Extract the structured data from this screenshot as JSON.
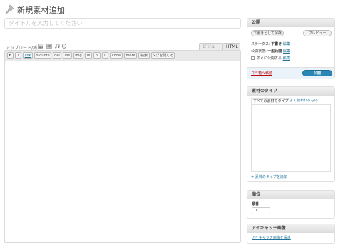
{
  "header": {
    "title": "新規素材追加",
    "icon": "pin-icon"
  },
  "title_field": {
    "placeholder": "タイトルを入力してください",
    "value": ""
  },
  "media": {
    "upload_label": "アップロード/挿入",
    "icons": [
      "image-icon",
      "video-icon",
      "music-icon",
      "media-circle-icon"
    ]
  },
  "editor_tabs": {
    "visual": "ビジュアル",
    "html": "HTML",
    "active": "HTML"
  },
  "quicktags": [
    "b",
    "i",
    "link",
    "b-quote",
    "del",
    "ins",
    "img",
    "ul",
    "ol",
    "li",
    "code",
    "more",
    "検索",
    "タグを閉じる"
  ],
  "publish": {
    "title": "公開",
    "save_draft": "下書きとして保存",
    "preview": "プレビュー",
    "status_label": "ステータス:",
    "status_value": "下書き",
    "status_edit": "編集",
    "visibility_label": "公開状態:",
    "visibility_value": "一般公開",
    "visibility_edit": "編集",
    "schedule_label": "すぐに公開する",
    "schedule_edit": "編集",
    "trash": "ゴミ箱へ移動",
    "publish_button": "公開",
    "accent_color": "#2a86b4"
  },
  "material_type": {
    "title": "素材のタイプ",
    "tab_all": "すべての素材のタイプ",
    "tab_popular": "よく使われるもの",
    "add_new": "+ 素材のタイプを追加"
  },
  "order": {
    "title": "順位",
    "label": "順番",
    "value": "0"
  },
  "thumbnail": {
    "title": "アイキャッチ画像",
    "set_link": "アイキャッチ画像を設定"
  }
}
